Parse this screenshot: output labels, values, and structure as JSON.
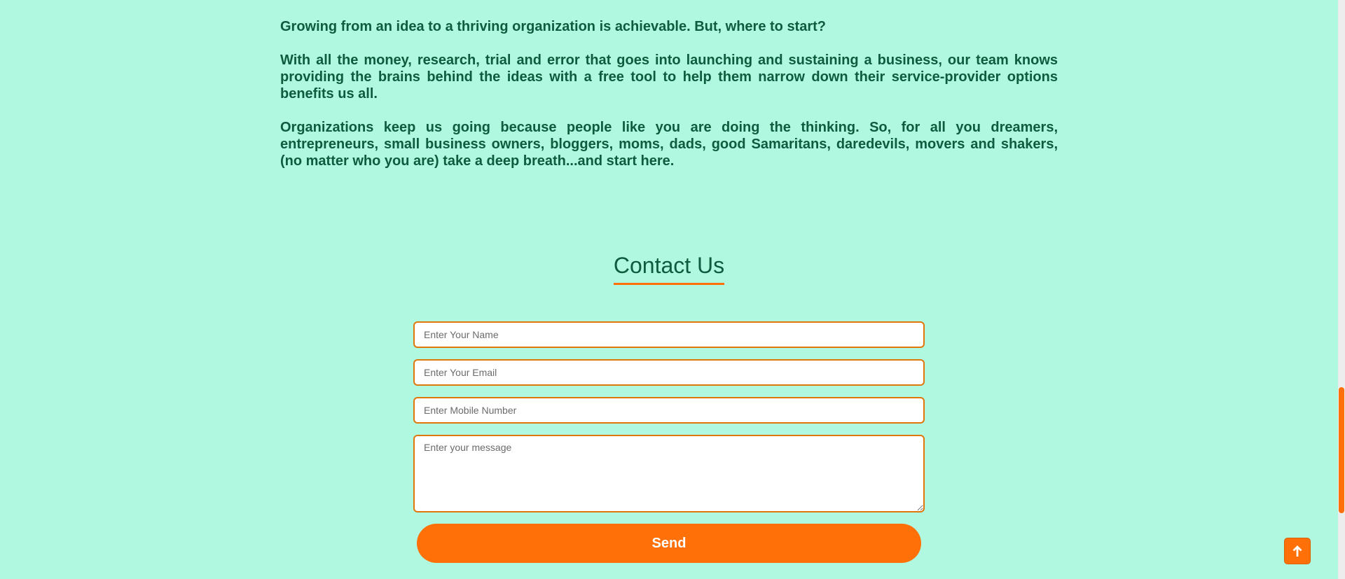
{
  "about": {
    "paragraphs": [
      "Growing from an idea to a thriving organization is achievable. But, where to start?",
      "With all the money, research, trial and error that goes into launching and sustaining a business, our team knows providing the brains behind the ideas with a free tool to help them narrow down their service-provider options benefits us all.",
      "Organizations keep us going because people like you are doing the thinking. So, for all you dreamers, entrepreneurs, small business owners, bloggers, moms, dads, good Samaritans, daredevils, movers and shakers, (no matter who you are) take a deep breath...and start here."
    ]
  },
  "contact": {
    "title": "Contact Us",
    "name_placeholder": "Enter Your Name",
    "email_placeholder": "Enter Your Email",
    "mobile_placeholder": "Enter Mobile Number",
    "message_placeholder": "Enter your message",
    "send_label": "Send"
  },
  "scroll_top": {
    "icon": "arrow-up-icon"
  },
  "colors": {
    "background": "#b0f8df",
    "text": "#0d5c3f",
    "accent": "#ff7008",
    "field_border": "#e0770a"
  }
}
